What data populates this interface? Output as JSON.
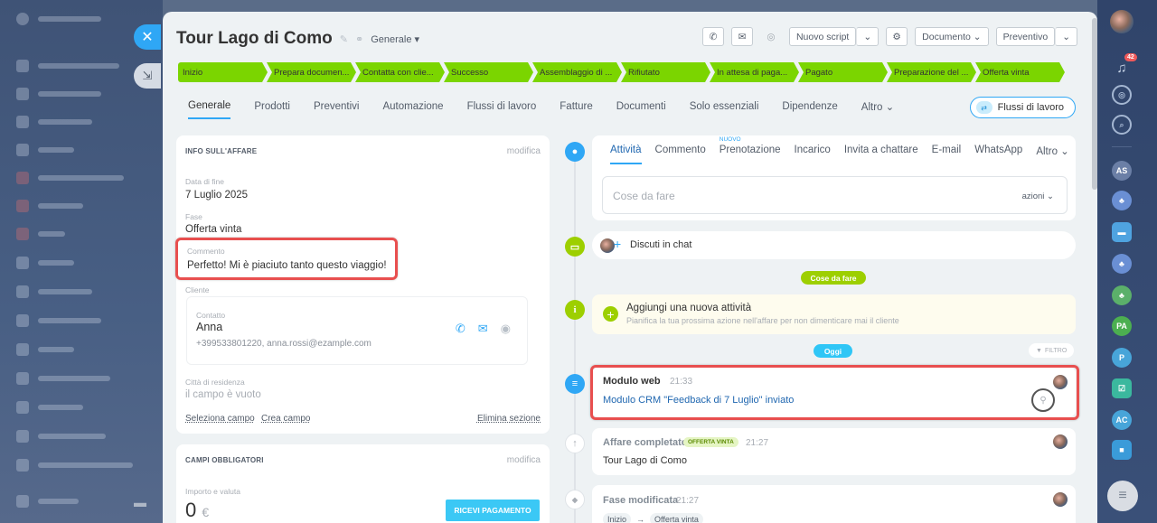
{
  "header": {
    "title": "Tour Lago di Como",
    "category": "Generale",
    "buttons": {
      "new_script": "Nuovo script",
      "document": "Documento",
      "quote": "Preventivo"
    }
  },
  "stages": [
    "Inizio",
    "Prepara documen...",
    "Contatta con clie...",
    "Successo",
    "Assemblaggio di ...",
    "Rifiutato",
    "In attesa di paga...",
    "Pagato",
    "Preparazione del ...",
    "Offerta vinta"
  ],
  "tabs": [
    "Generale",
    "Prodotti",
    "Preventivi",
    "Automazione",
    "Flussi di lavoro",
    "Fatture",
    "Documenti",
    "Solo essenziali",
    "Dipendenze",
    "Altro"
  ],
  "workflow_button": "Flussi di lavoro",
  "deal_info": {
    "title": "INFO SULL'AFFARE",
    "edit": "modifica",
    "end_date_label": "Data di fine",
    "end_date": "7 Luglio 2025",
    "stage_label": "Fase",
    "stage": "Offerta vinta",
    "comment_label": "Commento",
    "comment": "Perfetto! Mi è piaciuto tanto questo viaggio!",
    "client_label": "Cliente",
    "contact_label": "Contatto",
    "contact_name": "Anna",
    "contact_details": "+399533801220, anna.rossi@ezample.com",
    "city_label": "Città di residenza",
    "city_value": "il campo è vuoto",
    "select_field": "Seleziona campo",
    "create_field": "Crea campo",
    "delete_section": "Elimina sezione"
  },
  "required_fields": {
    "title": "CAMPI OBBLIGATORI",
    "edit": "modifica",
    "amount_label": "Importo e valuta",
    "amount": "0",
    "currency": "€",
    "pay_button": "RICEVI PAGAMENTO"
  },
  "activity": {
    "tabs": [
      "Attività",
      "Commento",
      "Prenotazione",
      "Incarico",
      "Invita a chattare",
      "E-mail",
      "WhatsApp",
      "Altro"
    ],
    "new_badge": "NUOVO",
    "todo_placeholder": "Cose da fare",
    "actions": "azioni",
    "discuss": "Discuti in chat",
    "todo_pill": "Cose da fare",
    "add_activity_title": "Aggiungi una nuova attività",
    "add_activity_sub": "Pianifica la tua prossima azione nell'affare per non dimenticare mai il cliente",
    "today_pill": "Oggi",
    "filter": "FILTRO"
  },
  "timeline": [
    {
      "title": "Modulo web",
      "time": "21:33",
      "text": "Modulo CRM \"Feedback di 7 Luglio\" inviato"
    },
    {
      "title": "Affare completato",
      "badge": "OFFERTA VINTA",
      "time": "21:27",
      "text": "Tour Lago di Como"
    },
    {
      "title": "Fase modificata",
      "time": "21:27",
      "from": "Inizio",
      "to": "Offerta vinta"
    }
  ],
  "right_bar": {
    "notifications": "42",
    "initials": [
      "AS",
      "PA",
      "P",
      "AC"
    ]
  },
  "colors": {
    "stage_green": "#7bd500",
    "accent_blue": "#2fa7f5",
    "highlight_red": "#e84f4f"
  }
}
